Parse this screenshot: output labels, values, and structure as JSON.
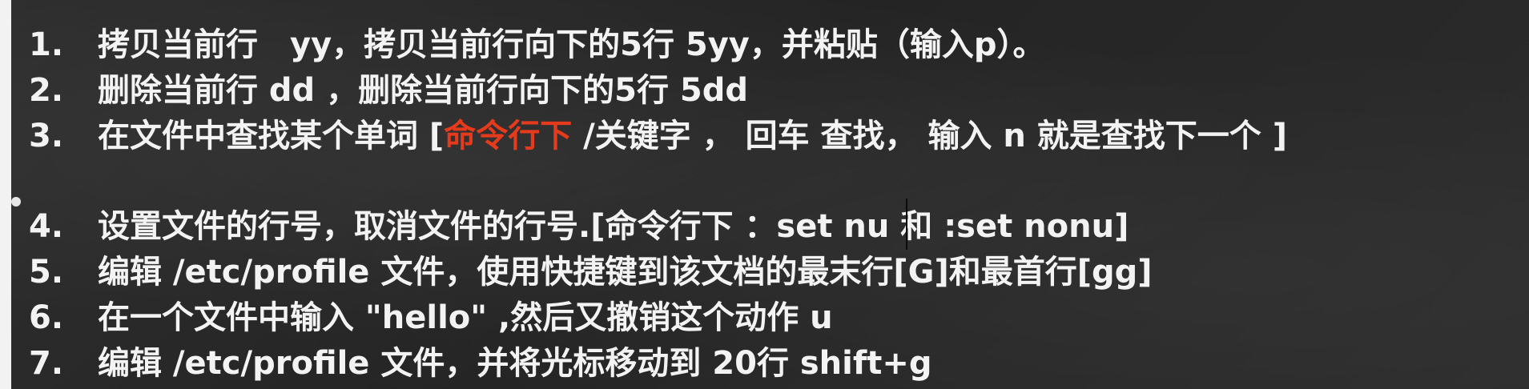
{
  "slide": {
    "items": [
      {
        "num": "1.",
        "text": "拷贝当前行　yy，拷贝当前行向下的5行  5yy，并粘贴（输入p）。"
      },
      {
        "num": "2.",
        "text": "删除当前行  dd ，删除当前行向下的5行 5dd"
      },
      {
        "num": "3.",
        "text_before": "在文件中查找某个单词 [",
        "highlight": "命令行下",
        "text_after": " /关键字 ，  回车 查找，  输入 n 就是查找下一个 ]"
      },
      {
        "num": "4.",
        "text": "设置文件的行号，取消文件的行号.[命令行下 ：set nu 和  :set nonu]"
      },
      {
        "num": "5.",
        "text": "编辑 /etc/profile 文件，使用快捷键到该文档的最末行[G]和最首行[gg]"
      },
      {
        "num": "6.",
        "text": "在一个文件中输入 \"hello\" ,然后又撤销这个动作  u"
      },
      {
        "num": "7.",
        "text": "编辑  /etc/profile 文件，并将光标移动到  20行 shift+g"
      }
    ]
  },
  "colors": {
    "background": "#2a2a2a",
    "text": "#f3f3f3",
    "highlight": "#e53a1b"
  }
}
